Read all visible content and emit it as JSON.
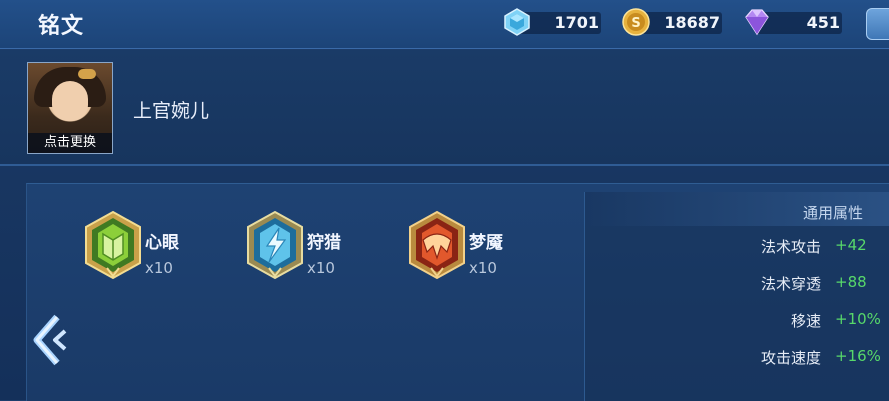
{
  "header": {
    "title": "铭文",
    "currencies": [
      {
        "name": "crystal",
        "icon": "crystal-icon",
        "value": "1701",
        "color": "#6fc6f0"
      },
      {
        "name": "gold",
        "icon": "gold-coin-icon",
        "value": "18687",
        "color": "#e2ad3c"
      },
      {
        "name": "diamond",
        "icon": "diamond-icon",
        "value": "451",
        "color": "#b27ff0"
      }
    ]
  },
  "hero": {
    "name": "上官婉儿",
    "change_label": "点击更换"
  },
  "runes": [
    {
      "name": "心眼",
      "count": "x10",
      "color": "#7fbf3f",
      "icon": "xinyan-rune-icon"
    },
    {
      "name": "狩猎",
      "count": "x10",
      "color": "#4fb8e0",
      "icon": "shoulie-rune-icon"
    },
    {
      "name": "梦魇",
      "count": "x10",
      "color": "#e0582e",
      "icon": "mengyan-rune-icon"
    }
  ],
  "stats": {
    "title": "通用属性",
    "items": [
      {
        "name": "法术攻击",
        "value": "+42"
      },
      {
        "name": "法术穿透",
        "value": "+88"
      },
      {
        "name": "移速",
        "value": "+10%"
      },
      {
        "name": "攻击速度",
        "value": "+16%"
      }
    ]
  }
}
